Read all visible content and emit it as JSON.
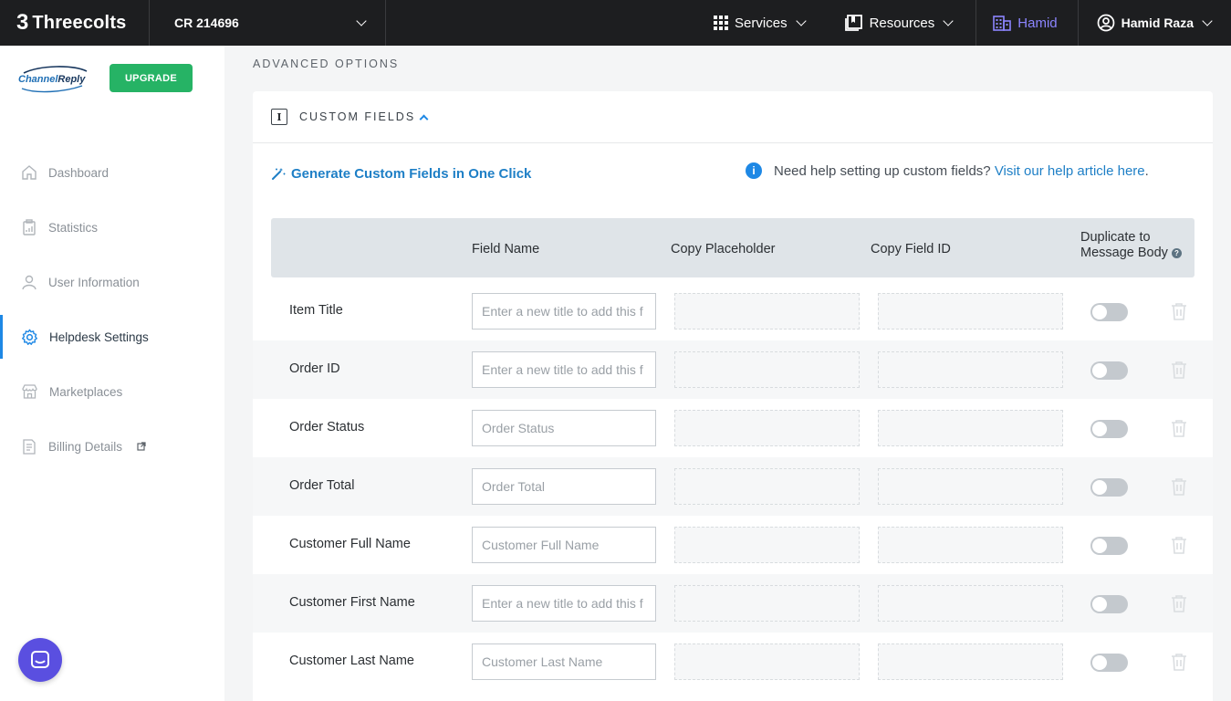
{
  "topbar": {
    "brand": "Threecolts",
    "brand_mark": "3",
    "account_label": "CR 214696",
    "services_label": "Services",
    "resources_label": "Resources",
    "org_label": "Hamid",
    "user_label": "Hamid Raza",
    "org_color": "#8c85ff"
  },
  "sidebar": {
    "logo_text_a": "Channel",
    "logo_text_b": "Reply",
    "upgrade_label": "UPGRADE",
    "items": [
      {
        "label": "Dashboard",
        "icon": "home-icon"
      },
      {
        "label": "Statistics",
        "icon": "clipboard-icon"
      },
      {
        "label": "User Information",
        "icon": "user-icon"
      },
      {
        "label": "Helpdesk Settings",
        "icon": "gear-icon",
        "active": true
      },
      {
        "label": "Marketplaces",
        "icon": "store-icon"
      },
      {
        "label": "Billing Details",
        "icon": "invoice-icon",
        "external": true
      }
    ]
  },
  "main": {
    "section_title": "ADVANCED OPTIONS",
    "card_title": "CUSTOM FIELDS",
    "generate_link": "Generate Custom Fields in One Click",
    "help_text": "Need help setting up custom fields?",
    "help_link": "Visit our help article here",
    "help_period": ".",
    "columns": {
      "field_name": "Field Name",
      "copy_placeholder": "Copy Placeholder",
      "copy_field_id": "Copy Field ID",
      "duplicate_line1": "Duplicate to",
      "duplicate_line2": "Message Body",
      "help_mark": "?"
    },
    "rows": [
      {
        "label": "Item Title",
        "placeholder": "Enter a new title to add this f"
      },
      {
        "label": "Order ID",
        "placeholder": "Enter a new title to add this f"
      },
      {
        "label": "Order Status",
        "placeholder": "Order Status"
      },
      {
        "label": "Order Total",
        "placeholder": "Order Total"
      },
      {
        "label": "Customer Full Name",
        "placeholder": "Customer Full Name"
      },
      {
        "label": "Customer First Name",
        "placeholder": "Enter a new title to add this f"
      },
      {
        "label": "Customer Last Name",
        "placeholder": "Customer Last Name"
      }
    ]
  },
  "colors": {
    "accent": "#1e88e5",
    "upgrade": "#26b365",
    "chat": "#5a4fe0"
  }
}
